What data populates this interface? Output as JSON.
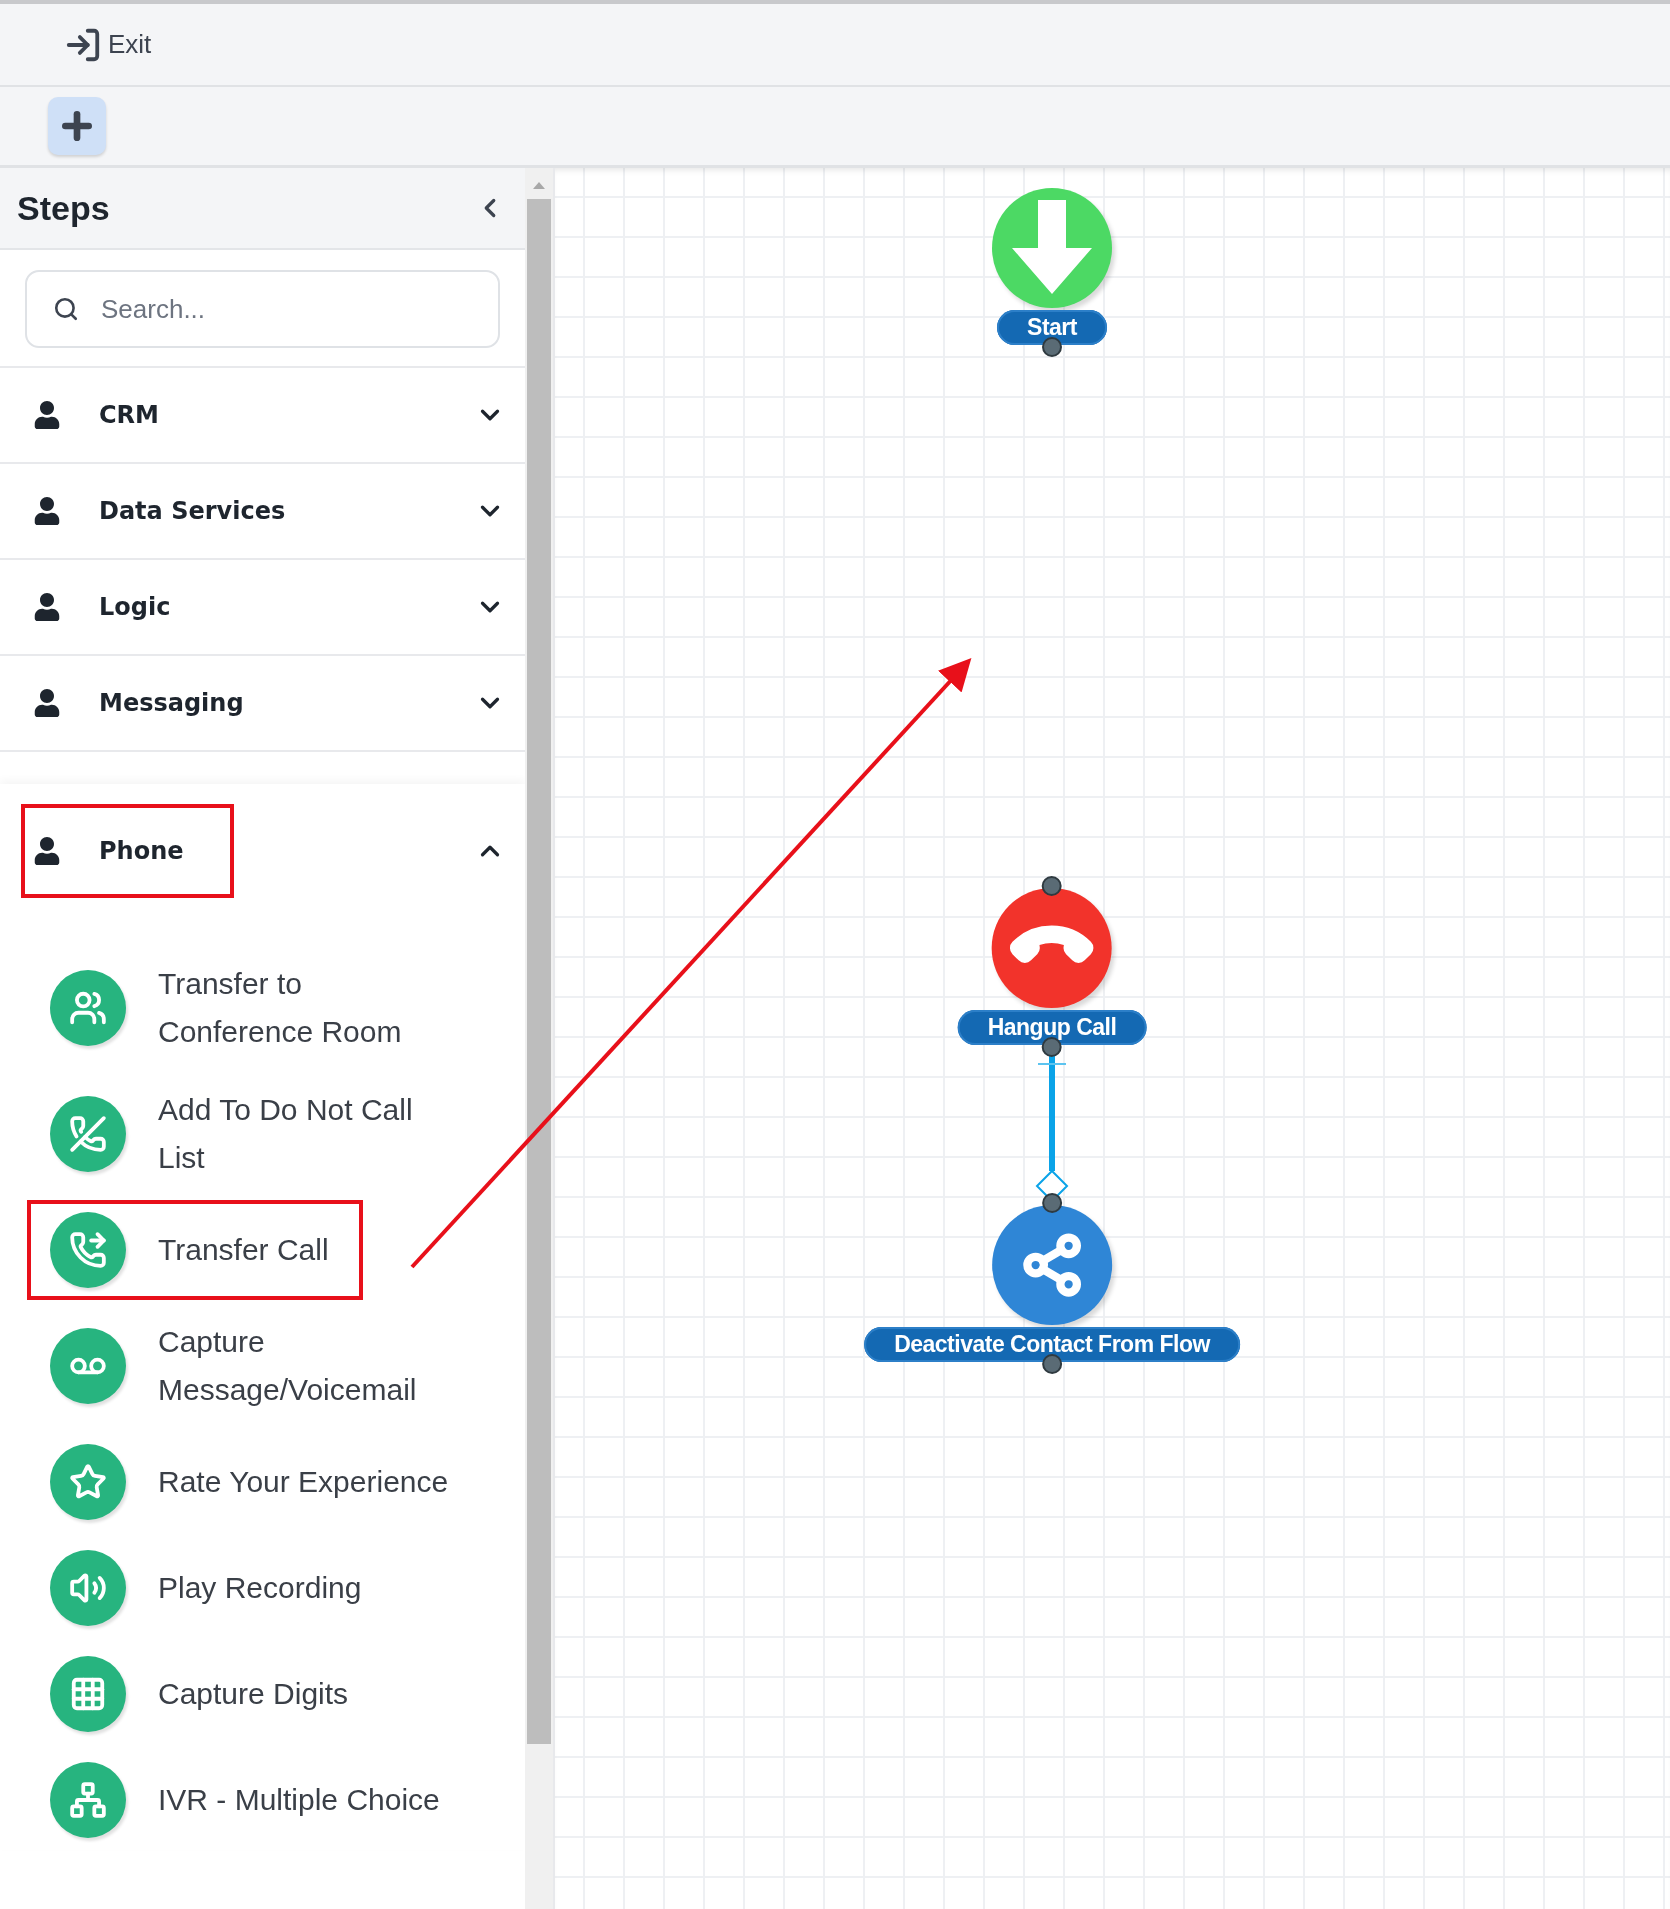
{
  "toolbar": {
    "exit_label": "Exit"
  },
  "sidebar": {
    "title": "Steps",
    "search": {
      "placeholder": "Search..."
    },
    "categories": [
      {
        "label": "CRM",
        "expanded": false,
        "highlighted": false
      },
      {
        "label": "Data Services",
        "expanded": false,
        "highlighted": false
      },
      {
        "label": "Logic",
        "expanded": false,
        "highlighted": false
      },
      {
        "label": "Messaging",
        "expanded": false,
        "highlighted": false
      },
      {
        "label": "Phone",
        "expanded": true,
        "highlighted": true,
        "steps": [
          {
            "label": "Transfer to Conference Room",
            "kind": "conference",
            "highlighted": false
          },
          {
            "label": "Add To Do Not Call List",
            "kind": "donotcall",
            "highlighted": false
          },
          {
            "label": "Transfer Call",
            "kind": "transfer",
            "highlighted": true
          },
          {
            "label": "Capture Message/Voicemail",
            "kind": "voicemail",
            "highlighted": false
          },
          {
            "label": "Rate Your Experience",
            "kind": "rate",
            "highlighted": false
          },
          {
            "label": "Play Recording",
            "kind": "play",
            "highlighted": false
          },
          {
            "label": "Capture Digits",
            "kind": "digits",
            "highlighted": false
          },
          {
            "label": "IVR - Multiple Choice",
            "kind": "ivr",
            "highlighted": false
          }
        ]
      }
    ]
  },
  "canvas": {
    "nodes": [
      {
        "label": "Start",
        "kind": "start"
      },
      {
        "label": "Hangup Call",
        "kind": "hangup"
      },
      {
        "label": "Deactivate Contact From Flow",
        "kind": "deactivate"
      }
    ]
  }
}
